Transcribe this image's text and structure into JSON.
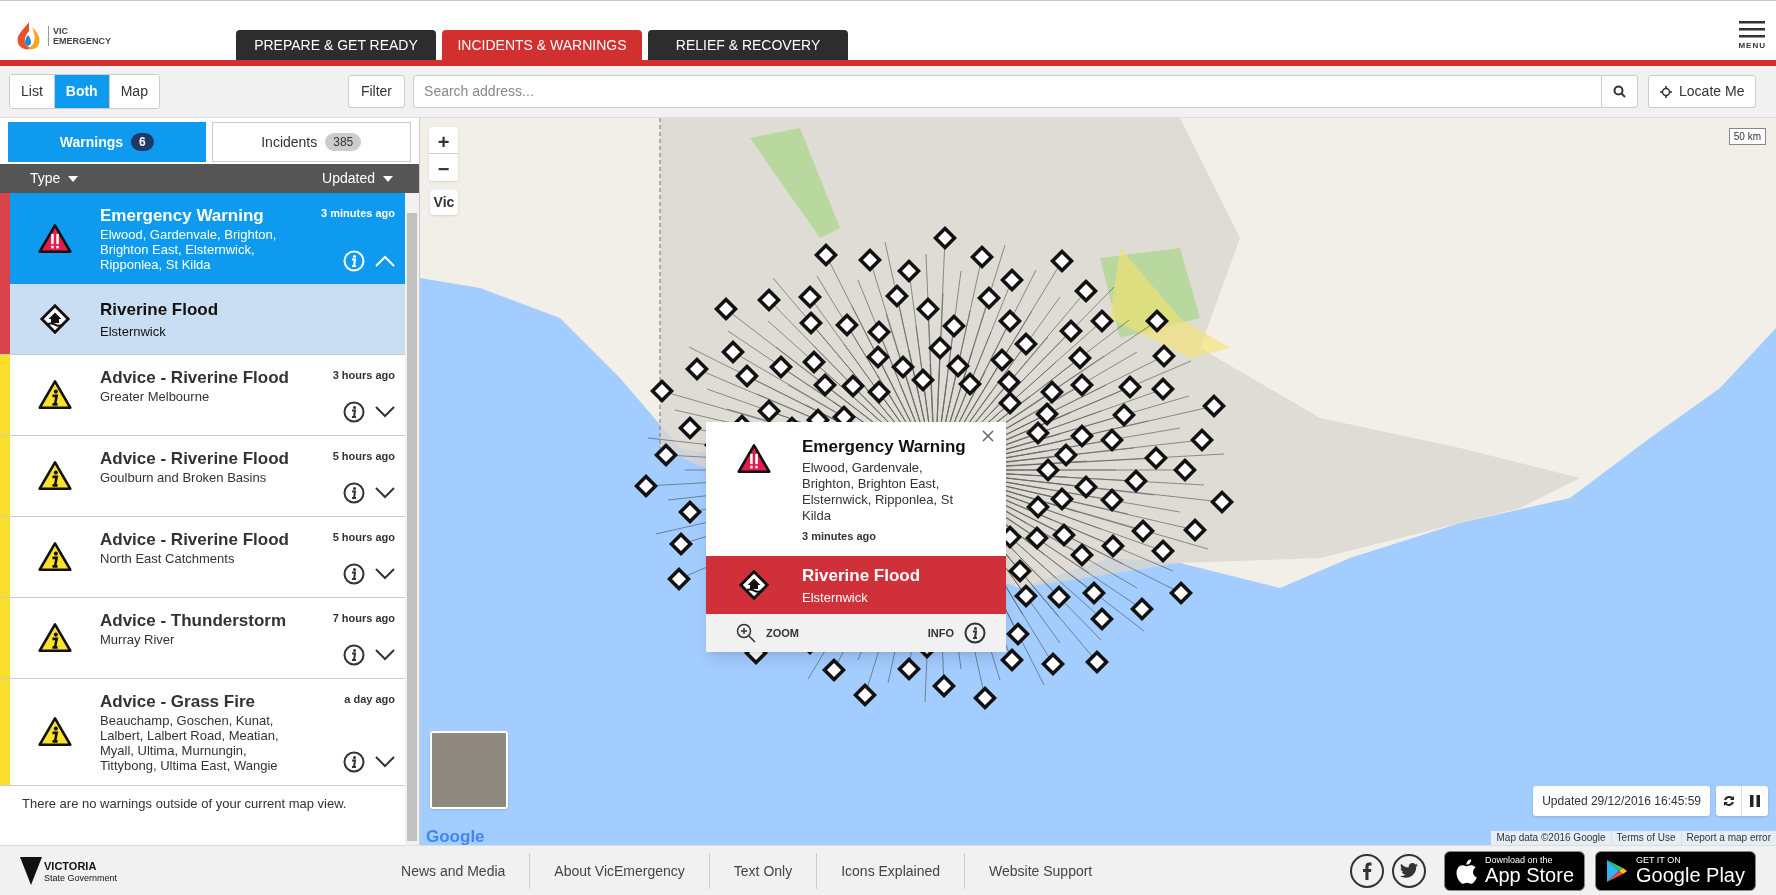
{
  "header": {
    "logo_lines": [
      "VIC",
      "EMERGENCY"
    ],
    "tabs": [
      {
        "label": "PREPARE & GET READY",
        "selected": false
      },
      {
        "label": "INCIDENTS & WARNINGS",
        "selected": true
      },
      {
        "label": "RELIEF & RECOVERY",
        "selected": false
      }
    ],
    "menu_label": "MENU"
  },
  "toolbar": {
    "view_modes": [
      {
        "label": "List",
        "selected": false
      },
      {
        "label": "Both",
        "selected": true
      },
      {
        "label": "Map",
        "selected": false
      }
    ],
    "filter_label": "Filter",
    "search": {
      "placeholder": "Search address..."
    },
    "locate_label": "Locate Me"
  },
  "sidebar": {
    "tabs": [
      {
        "label": "Warnings",
        "count": "6",
        "selected": true
      },
      {
        "label": "Incidents",
        "count": "385",
        "selected": false
      }
    ],
    "sort": [
      "Type",
      "Updated"
    ],
    "warnings": [
      {
        "kind": "emergency",
        "color": "#d9434a",
        "selected": true,
        "expanded": true,
        "title": "Emergency Warning",
        "areas": "Elwood, Gardenvale, Brighton, Brighton East, Elsternwick, Ripponlea, St Kilda",
        "time": "3 minutes ago",
        "children": [
          {
            "kind": "flood",
            "title": "Riverine Flood",
            "areas": "Elsternwick"
          }
        ]
      },
      {
        "kind": "advice",
        "color": "#f9df2c",
        "selected": false,
        "expanded": false,
        "title": "Advice - Riverine Flood",
        "areas": "Greater Melbourne",
        "time": "3 hours ago"
      },
      {
        "kind": "advice",
        "color": "#f9df2c",
        "selected": false,
        "expanded": false,
        "title": "Advice - Riverine Flood",
        "areas": "Goulburn and Broken Basins",
        "time": "5 hours ago"
      },
      {
        "kind": "advice",
        "color": "#f9df2c",
        "selected": false,
        "expanded": false,
        "title": "Advice - Riverine Flood",
        "areas": "North East Catchments",
        "time": "5 hours ago"
      },
      {
        "kind": "advice",
        "color": "#f9df2c",
        "selected": false,
        "expanded": false,
        "title": "Advice - Thunderstorm",
        "areas": "Murray River",
        "time": "7 hours ago"
      },
      {
        "kind": "advice",
        "color": "#f9df2c",
        "selected": false,
        "expanded": false,
        "title": "Advice - Grass Fire",
        "areas": "Beauchamp, Goschen, Kunat, Lalbert, Lalbert Road, Meatian, Myall, Ultima, Murnungin, Tittybong, Ultima East, Wangie",
        "time": "a day ago"
      }
    ],
    "message": "There are no warnings outside of your current map view."
  },
  "map": {
    "zoom_in": "+",
    "zoom_out": "−",
    "region_button": "Vic",
    "scale": "50 km",
    "popup": {
      "kind": "emergency",
      "title": "Emergency Warning",
      "areas": "Elwood, Gardenvale, Brighton, Brighton East, Elsternwick, Ripponlea, St Kilda",
      "time": "3 minutes ago",
      "incident": {
        "kind": "flood",
        "title": "Riverine Flood",
        "areas": "Elsternwick"
      },
      "actions": [
        "ZOOM",
        "INFO"
      ]
    },
    "google_logo": "Google",
    "updated": "Updated 29/12/2016 16:45:59",
    "attribution": [
      "Map data ©2016 Google",
      "Terms of Use",
      "Report a map error"
    ]
  },
  "footer": {
    "logo_lines": [
      "VICTORIA",
      "State Government"
    ],
    "links": [
      "News and Media",
      "About VicEmergency",
      "Text Only",
      "Icons Explained",
      "Website Support"
    ],
    "apps": [
      {
        "kind": "apple",
        "small": "Download on the",
        "big": "App Store"
      },
      {
        "kind": "google",
        "small": "GET IT ON",
        "big": "Google Play"
      }
    ]
  }
}
